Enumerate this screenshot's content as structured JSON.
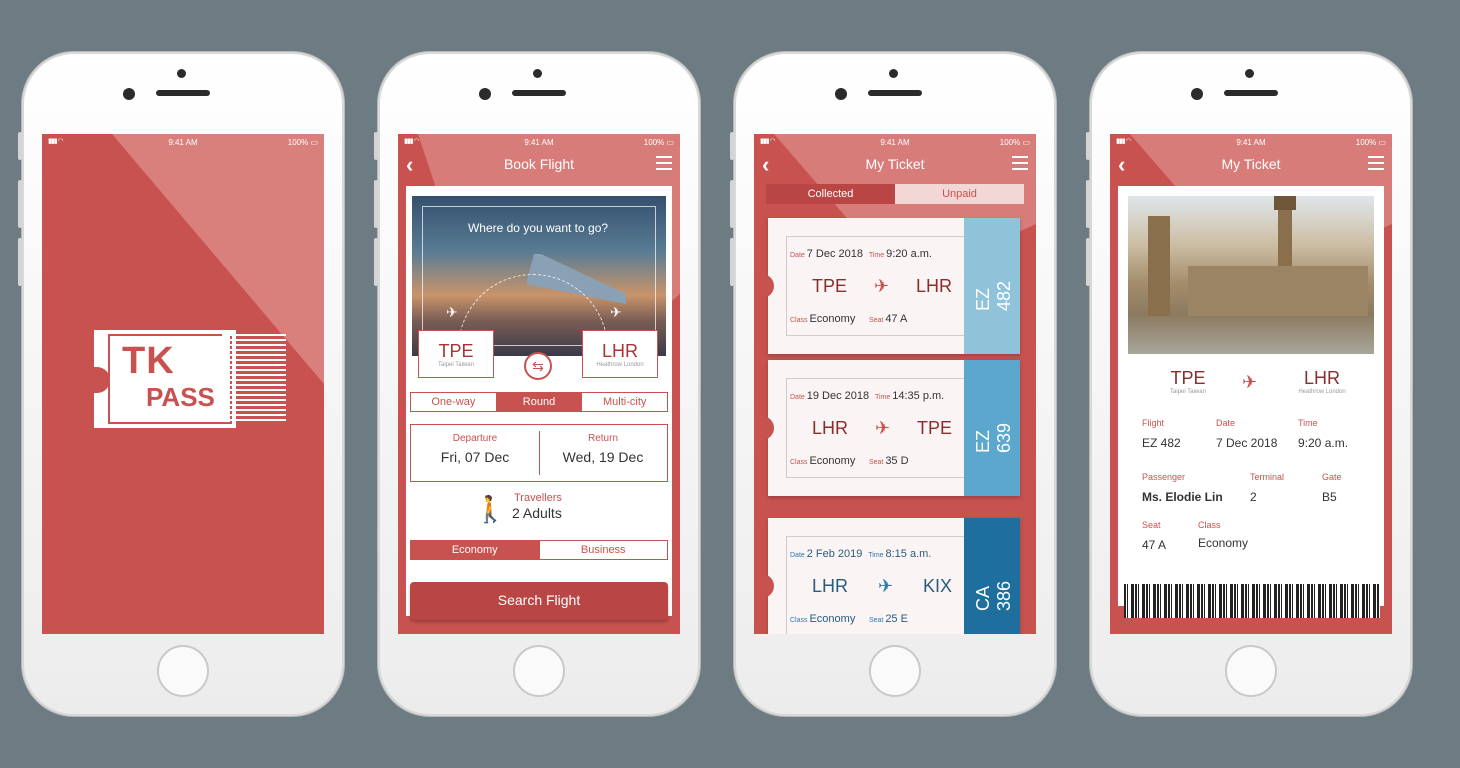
{
  "status": {
    "time": "9:41 AM",
    "battery": "100%"
  },
  "screen1": {
    "logo_top": "TK",
    "logo_bottom": "PASS"
  },
  "screen2": {
    "title": "Book Flight",
    "prompt": "Where do you want to go?",
    "from": {
      "code": "TPE",
      "name": "Taipei Taiwan"
    },
    "to": {
      "code": "LHR",
      "name": "Heathrow London"
    },
    "trip_types": [
      "One-way",
      "Round",
      "Multi-city"
    ],
    "trip_selected": "Round",
    "departure_label": "Departure",
    "departure_value": "Fri, 07 Dec",
    "return_label": "Return",
    "return_value": "Wed, 19 Dec",
    "travellers_label": "Travellers",
    "travellers_value": "2 Adults",
    "cabin": [
      "Economy",
      "Business"
    ],
    "cabin_selected": "Economy",
    "search_label": "Search Flight"
  },
  "screen3": {
    "title": "My Ticket",
    "tabs": [
      "Collected",
      "Unpaid"
    ],
    "tickets": [
      {
        "date_label": "Date",
        "date": "7 Dec 2018",
        "time_label": "Time",
        "time": "9:20 a.m.",
        "from": "TPE",
        "to": "LHR",
        "class_label": "Class",
        "class": "Economy",
        "seat_label": "Seat",
        "seat": "47 A",
        "flight": "EZ 482",
        "color": "#8fc3da"
      },
      {
        "date_label": "Date",
        "date": "19 Dec 2018",
        "time_label": "Time",
        "time": "14:35 p.m.",
        "from": "LHR",
        "to": "TPE",
        "class_label": "Class",
        "class": "Economy",
        "seat_label": "Seat",
        "seat": "35 D",
        "flight": "EZ 639",
        "color": "#5ba7cd"
      },
      {
        "date_label": "Date",
        "date": "2 Feb 2019",
        "time_label": "Time",
        "time": "8:15 a.m.",
        "from": "LHR",
        "to": "KIX",
        "class_label": "Class",
        "class": "Economy",
        "seat_label": "Seat",
        "seat": "25 E",
        "flight": "CA 386",
        "color": "#1f6f9e"
      }
    ]
  },
  "screen4": {
    "title": "My Ticket",
    "from": {
      "code": "TPE",
      "name": "Taipei Taiwan"
    },
    "to": {
      "code": "LHR",
      "name": "Heathrow London"
    },
    "flight_label": "Flight",
    "flight": "EZ 482",
    "date_label": "Date",
    "date": "7 Dec 2018",
    "time_label": "Time",
    "time": "9:20 a.m.",
    "passenger_label": "Passenger",
    "passenger": "Ms. Elodie Lin",
    "terminal_label": "Terminal",
    "terminal": "2",
    "gate_label": "Gate",
    "gate": "B5",
    "seat_label": "Seat",
    "seat": "47 A",
    "class_label": "Class",
    "class": "Economy"
  },
  "colors": {
    "brand": "#c7524f",
    "dark_brand": "#8b2d2d",
    "ticket_blue": "#5ba7cd"
  }
}
